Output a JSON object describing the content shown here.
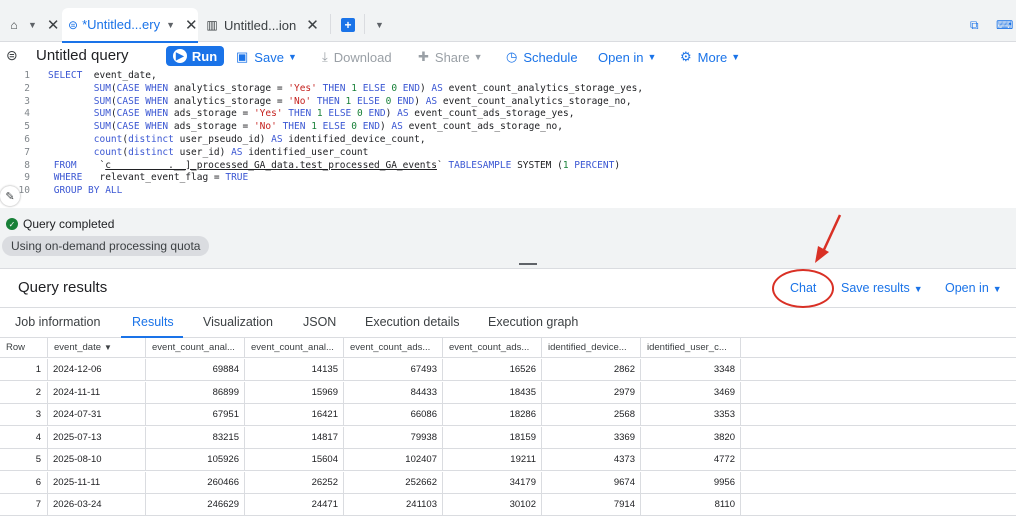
{
  "tabs": {
    "home_icon": "home-icon",
    "active_label": "*Untitled...ery",
    "second_label": "Untitled...ion"
  },
  "toolbar": {
    "title": "Untitled query",
    "run": "Run",
    "save": "Save",
    "download": "Download",
    "share": "Share",
    "schedule": "Schedule",
    "open_in": "Open in",
    "more": "More"
  },
  "editor": {
    "line_numbers": [
      "1",
      "2",
      "3",
      "4",
      "5",
      "6",
      "7",
      "8",
      "9",
      "10"
    ]
  },
  "status": {
    "completed": "Query completed",
    "quota": "Using on-demand processing quota"
  },
  "results": {
    "title": "Query results",
    "chat": "Chat",
    "save_results": "Save results",
    "open_in": "Open in",
    "tabs": [
      "Job information",
      "Results",
      "Visualization",
      "JSON",
      "Execution details",
      "Execution graph"
    ],
    "columns": [
      "Row",
      "event_date",
      "event_count_anal...",
      "event_count_anal...",
      "event_count_ads...",
      "event_count_ads...",
      "identified_device...",
      "identified_user_c..."
    ],
    "rows": [
      [
        "1",
        "2024-12-06",
        "69884",
        "14135",
        "67493",
        "16526",
        "2862",
        "3348"
      ],
      [
        "2",
        "2024-11-11",
        "86899",
        "15969",
        "84433",
        "18435",
        "2979",
        "3469"
      ],
      [
        "3",
        "2024-07-31",
        "67951",
        "16421",
        "66086",
        "18286",
        "2568",
        "3353"
      ],
      [
        "4",
        "2025-07-13",
        "83215",
        "14817",
        "79938",
        "18159",
        "3369",
        "3820"
      ],
      [
        "5",
        "2025-08-10",
        "105926",
        "15604",
        "102407",
        "19211",
        "4373",
        "4772"
      ],
      [
        "6",
        "2025-11-11",
        "260466",
        "26252",
        "252662",
        "34179",
        "9674",
        "9956"
      ],
      [
        "7",
        "2026-03-24",
        "246629",
        "24471",
        "241103",
        "30102",
        "7914",
        "8110"
      ]
    ]
  }
}
